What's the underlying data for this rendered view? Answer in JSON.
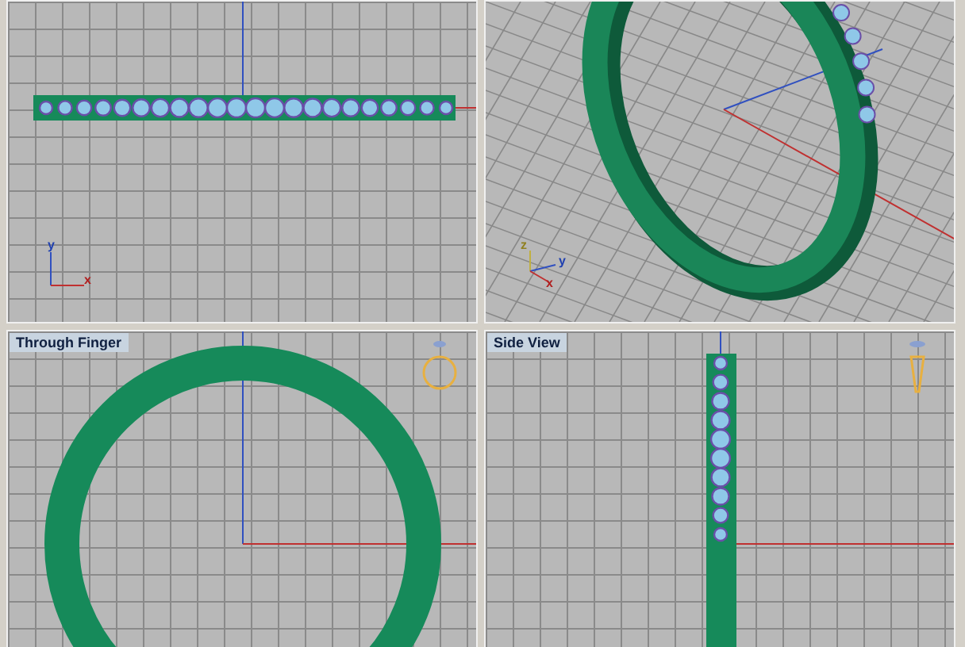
{
  "viewports": [
    {
      "kind": "top",
      "axes": [
        "y",
        "x"
      ]
    },
    {
      "kind": "perspective",
      "axes": [
        "z",
        "y",
        "x"
      ]
    },
    {
      "kind": "front",
      "label": "Through Finger"
    },
    {
      "kind": "side",
      "label": "Side View"
    }
  ]
}
